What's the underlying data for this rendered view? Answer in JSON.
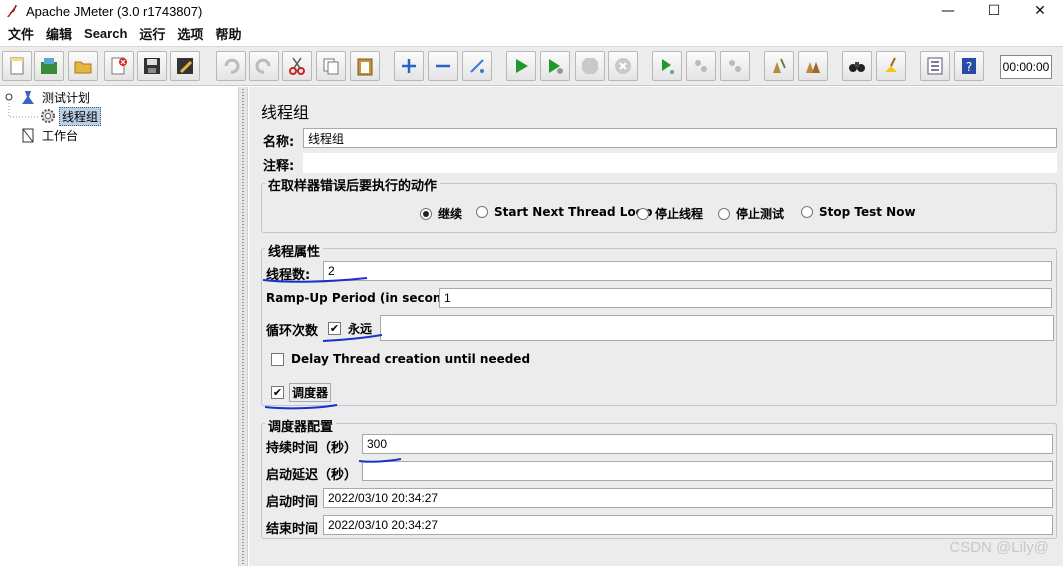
{
  "window": {
    "title": "Apache JMeter (3.0 r1743807)",
    "minimize_glyph": "—",
    "maximize_glyph": "☐",
    "close_glyph": "✕"
  },
  "menu": [
    "文件",
    "编辑",
    "Search",
    "运行",
    "选项",
    "帮助"
  ],
  "toolbar": {
    "icons": [
      "new-icon",
      "templates-icon",
      "open-icon",
      "close-file-icon",
      "save-icon",
      "save-as-icon",
      "undo-icon",
      "redo-icon",
      "cut-icon",
      "copy-icon",
      "paste-icon",
      "expand-icon",
      "collapse-icon",
      "toggle-icon",
      "start-icon",
      "start-no-pause-icon",
      "stop-icon",
      "shutdown-icon",
      "remote-start-icon",
      "remote-stop-icon",
      "remote-shutdown-icon",
      "clear-icon",
      "clear-all-icon",
      "search-icon",
      "reset-search-icon",
      "function-helper-icon",
      "help-icon"
    ],
    "timer": "00:00:00"
  },
  "tree": {
    "test_plan": "测试计划",
    "thread_group": "线程组",
    "workbench": "工作台"
  },
  "panel": {
    "title": "线程组",
    "name_label": "名称:",
    "name_value": "线程组",
    "comment_label": "注释:",
    "comment_value": "",
    "error_group_title": "在取样器错误后要执行的动作",
    "error_actions": [
      {
        "label": "继续",
        "selected": true
      },
      {
        "label": "Start Next Thread Loop",
        "selected": false
      },
      {
        "label": "停止线程",
        "selected": false
      },
      {
        "label": "停止测试",
        "selected": false
      },
      {
        "label": "Stop Test Now",
        "selected": false
      }
    ],
    "thread_props_title": "线程属性",
    "threads_label": "线程数:",
    "threads_value": "2",
    "rampup_label": "Ramp-Up Period (in seconds):",
    "rampup_value": "1",
    "loop_label": "循环次数",
    "loop_forever_label": "永远",
    "loop_forever_checked": true,
    "loop_value": "",
    "delay_label": "Delay Thread creation until needed",
    "delay_checked": false,
    "scheduler_label": "调度器",
    "scheduler_checked": true,
    "scheduler_config_title": "调度器配置",
    "duration_label": "持续时间（秒）",
    "duration_value": "300",
    "startup_delay_label": "启动延迟（秒）",
    "startup_delay_value": "",
    "start_time_label": "启动时间",
    "start_time_value": "2022/03/10 20:34:27",
    "end_time_label": "结束时间",
    "end_time_value": "2022/03/10 20:34:27"
  },
  "watermark": "CSDN @Lily@",
  "colors": {
    "annotation_ink": "#1a2fd0",
    "selection": "#b8cfe5",
    "panel_bg": "#ececec"
  }
}
